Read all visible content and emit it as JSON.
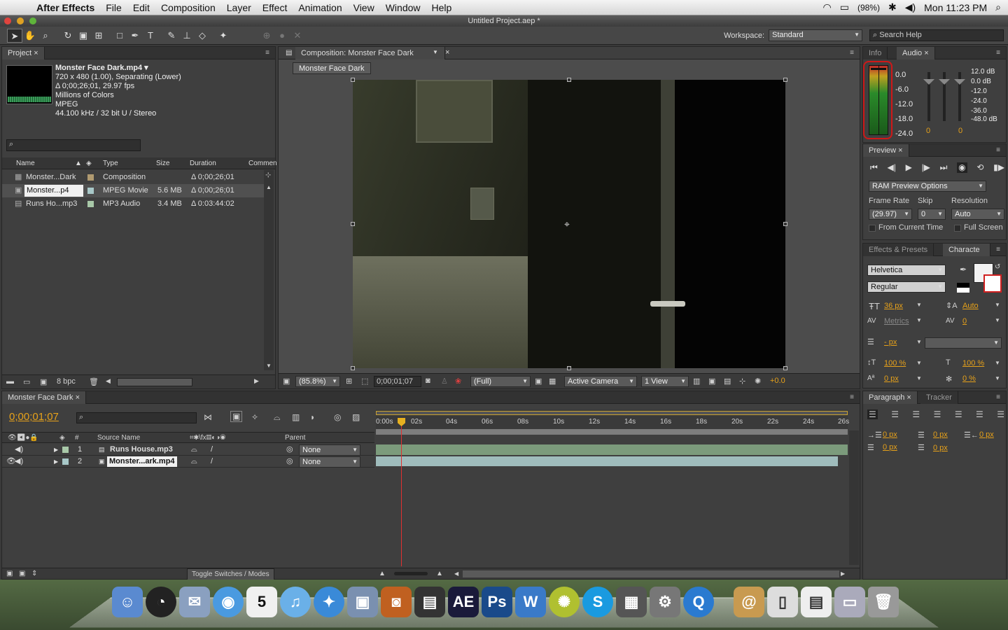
{
  "menubar": {
    "app": "After Effects",
    "items": [
      "File",
      "Edit",
      "Composition",
      "Layer",
      "Effect",
      "Animation",
      "View",
      "Window",
      "Help"
    ],
    "battery": "(98%)",
    "clock": "Mon 11:23 PM"
  },
  "window": {
    "title": "Untitled Project.aep *"
  },
  "toolbar": {
    "workspace_label": "Workspace:",
    "workspace_value": "Standard",
    "search_help": "Search Help"
  },
  "project": {
    "tab": "Project",
    "file_name": "Monster Face Dark.mp4 ▾",
    "info": [
      "720 x 480 (1.00), Separating (Lower)",
      "Δ 0;00;26;01, 29.97 fps",
      "Millions of Colors",
      "MPEG",
      "44.100 kHz / 32 bit U / Stereo"
    ],
    "columns": {
      "name": "Name",
      "type": "Type",
      "size": "Size",
      "duration": "Duration",
      "comment": "Commen"
    },
    "rows": [
      {
        "name": "Monster...Dark",
        "type": "Composition",
        "size": "",
        "duration": "Δ 0;00;26;01",
        "color": "#b09a70"
      },
      {
        "name": "Monster...p4",
        "type": "MPEG Movie",
        "size": "5.6 MB",
        "duration": "Δ 0;00;26;01",
        "color": "#a8c8c8"
      },
      {
        "name": "Runs Ho...mp3",
        "type": "MP3 Audio",
        "size": "3.4 MB",
        "duration": "Δ 0:03:44:02",
        "color": "#a8c8a8"
      }
    ],
    "bpc": "8 bpc"
  },
  "comp": {
    "tab": "Composition: Monster Face Dark",
    "subtab": "Monster Face Dark",
    "zoom": "(85.8%)",
    "timecode": "0;00;01;07",
    "quality": "(Full)",
    "camera": "Active Camera",
    "views": "1 View",
    "exposure": "+0.0"
  },
  "info_tab": "Info",
  "audio": {
    "tab": "Audio",
    "left_scale": [
      "0.0",
      "-6.0",
      "-12.0",
      "-18.0",
      "-24.0"
    ],
    "right_scale": [
      "12.0 dB",
      "0.0 dB",
      "-12.0",
      "-24.0",
      "-36.0",
      "-48.0 dB"
    ],
    "slider_vals": [
      "0",
      "0"
    ]
  },
  "preview": {
    "tab": "Preview",
    "ram": "RAM Preview Options",
    "frame_rate_label": "Frame Rate",
    "skip_label": "Skip",
    "resolution_label": "Resolution",
    "frame_rate": "(29.97)",
    "skip": "0",
    "resolution": "Auto",
    "from_current": "From Current Time",
    "full_screen": "Full Screen"
  },
  "effects_tab": "Effects & Presets",
  "character": {
    "tab": "Characte",
    "font": "Helvetica",
    "style": "Regular",
    "size": "36 px",
    "leading": "Auto",
    "kerning": "Metrics",
    "tracking": "0",
    "stroke": "- px",
    "vscale": "100 %",
    "hscale": "100 %",
    "baseline": "0 px",
    "tsume": "0 %"
  },
  "paragraph": {
    "tab": "Paragraph",
    "tracker_tab": "Tracker",
    "indent_left": "0 px",
    "indent_first": "0 px",
    "indent_right": "0 px",
    "space_before": "0 px",
    "space_after": "0 px"
  },
  "timeline": {
    "tab": "Monster Face Dark",
    "timecode": "0;00;01;07",
    "col_num": "#",
    "col_source": "Source Name",
    "col_parent": "Parent",
    "ruler": [
      "0:00s",
      "02s",
      "04s",
      "06s",
      "08s",
      "10s",
      "12s",
      "14s",
      "16s",
      "18s",
      "20s",
      "22s",
      "24s",
      "26s"
    ],
    "layers": [
      {
        "num": "1",
        "name": "Runs House.mp3",
        "parent": "None"
      },
      {
        "num": "2",
        "name": "Monster...ark.mp4",
        "parent": "None"
      }
    ],
    "toggle": "Toggle Switches / Modes"
  },
  "dock": [
    "Finder",
    "Dashboard",
    "Mail",
    "iChat",
    "iCal",
    "iTunes",
    "Safari",
    "iPhoto",
    "Image Capture",
    "Final Cut",
    "AE",
    "Ps",
    "Word",
    "LimeWire",
    "Skype",
    "Dashboard Apps",
    "System Prefs",
    "QuickTime",
    "Address",
    "Preview",
    "Torrent",
    "Finder Window",
    "Trash"
  ]
}
